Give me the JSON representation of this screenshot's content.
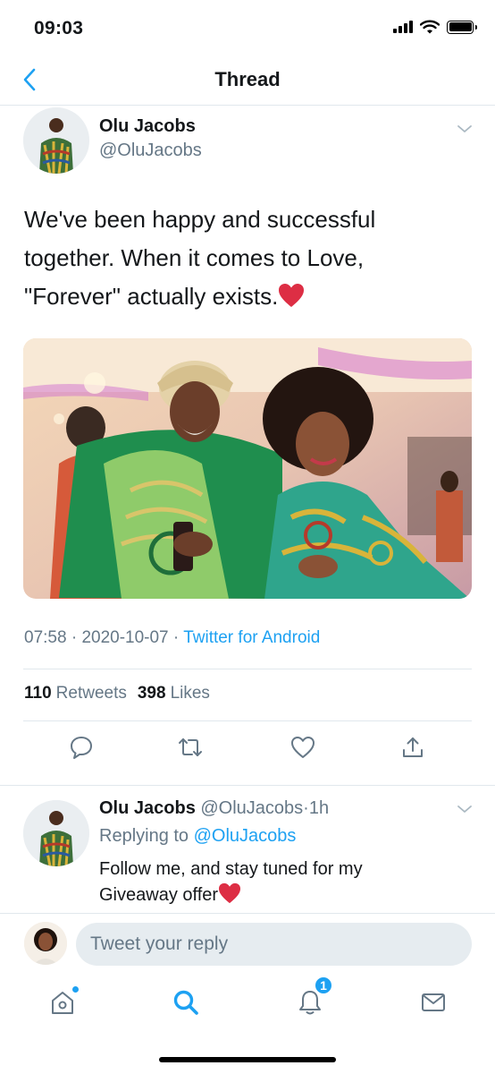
{
  "status_bar": {
    "time": "09:03"
  },
  "nav": {
    "title": "Thread"
  },
  "tweet": {
    "author_name": "Olu Jacobs",
    "author_handle": "@OluJacobs",
    "text": "We've been happy and successful together. When it comes to Love, \"Forever\" actually exists.",
    "time": "07:58",
    "date": "2020-10-07",
    "source": "Twitter for Android",
    "retweets": "110",
    "retweets_label": "Retweets",
    "likes": "398",
    "likes_label": "Likes"
  },
  "reply": {
    "author_name": "Olu Jacobs",
    "author_handle": "@OluJacobs",
    "age": "1h",
    "replying_prefix": "Replying to",
    "replying_to": "@OluJacobs",
    "text": "Follow me, and stay tuned for my Giveaway offer"
  },
  "compose": {
    "placeholder": "Tweet your reply"
  },
  "tabs": {
    "notifications_badge": "1"
  },
  "colors": {
    "accent": "#1da1f2",
    "muted": "#657786",
    "divider": "#e1e8ed",
    "heart": "#e0245e"
  },
  "icons": [
    "back-icon",
    "caret-down-icon",
    "reply-icon",
    "retweet-icon",
    "like-icon",
    "share-icon",
    "home-icon",
    "search-icon",
    "notifications-icon",
    "messages-icon",
    "heart-emoji"
  ]
}
